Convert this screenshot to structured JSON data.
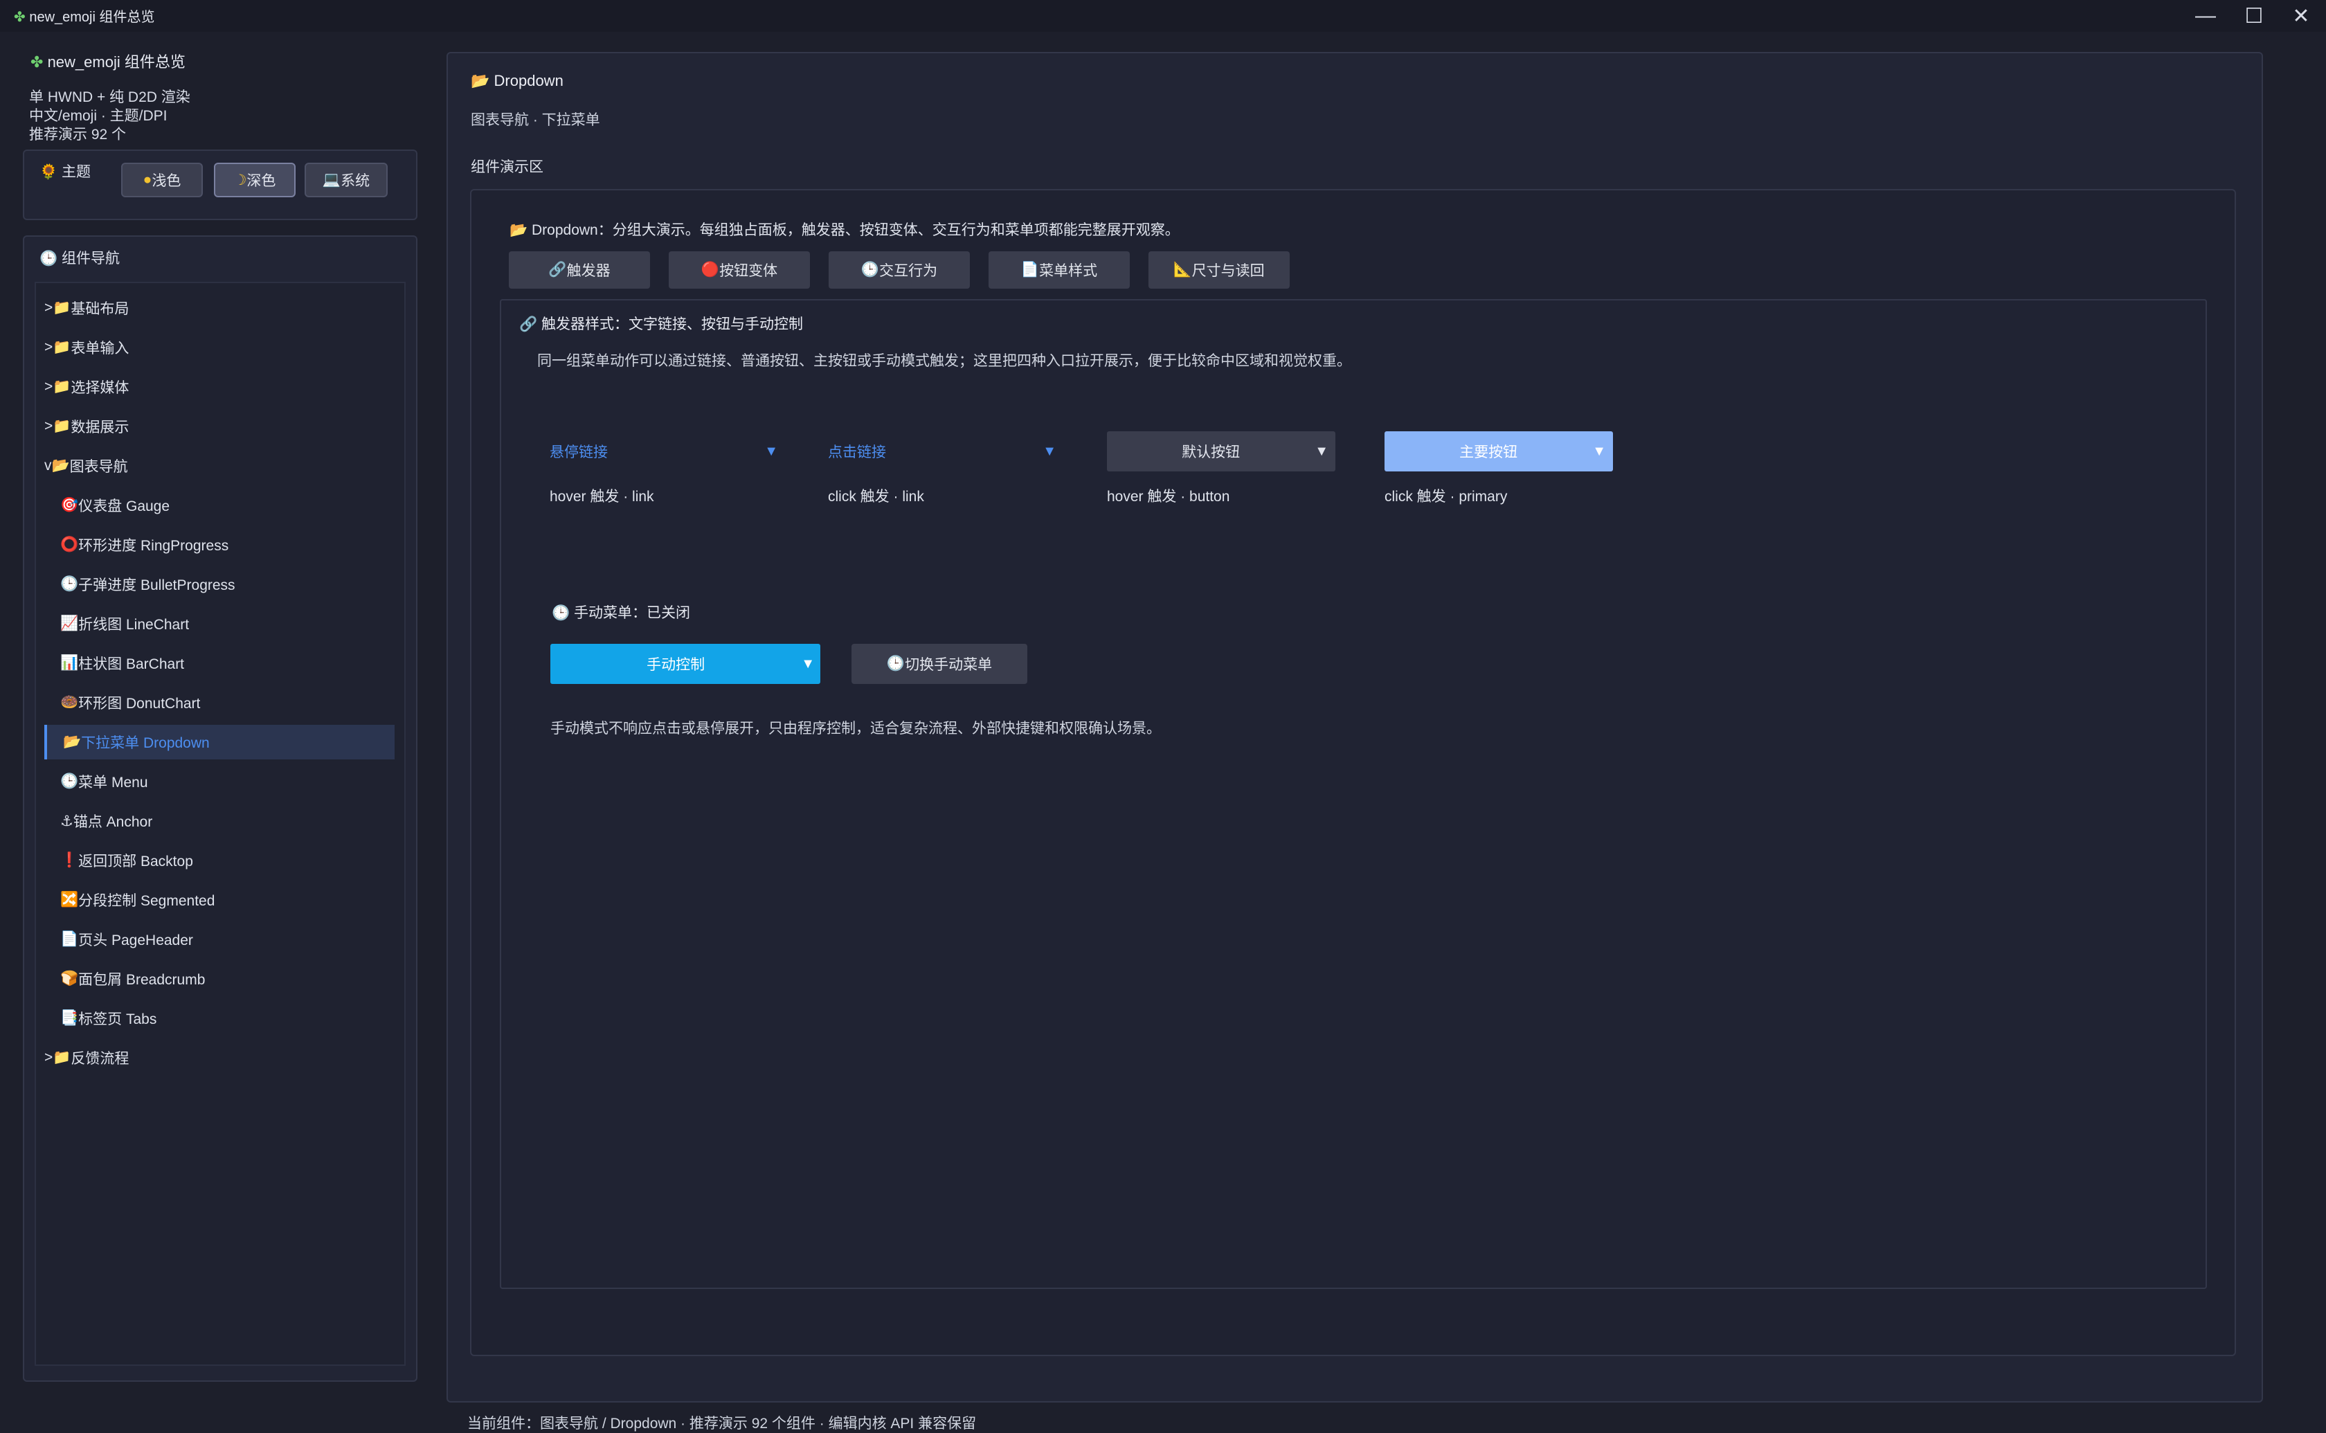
{
  "window": {
    "title": "new_emoji 组件总览"
  },
  "sidebar": {
    "brand": "new_emoji 组件总览",
    "info": [
      "单 HWND + 纯 D2D 渲染",
      "中文/emoji · 主题/DPI",
      "推荐演示 92 个"
    ],
    "theme": {
      "title": "主题",
      "options": [
        "浅色",
        "深色",
        "系统"
      ],
      "selected": "深色"
    },
    "nav": {
      "title": "组件导航",
      "items": [
        {
          "label": "基础布局",
          "prefix": ">"
        },
        {
          "label": "表单输入",
          "prefix": ">"
        },
        {
          "label": "选择媒体",
          "prefix": ">"
        },
        {
          "label": "数据展示",
          "prefix": ">"
        },
        {
          "label": "图表导航",
          "prefix": "v"
        },
        {
          "label": "仪表盘 Gauge"
        },
        {
          "label": "环形进度 RingProgress"
        },
        {
          "label": "子弹进度 BulletProgress"
        },
        {
          "label": "折线图 LineChart"
        },
        {
          "label": "柱状图 BarChart"
        },
        {
          "label": "环形图 DonutChart"
        },
        {
          "label": "下拉菜单 Dropdown"
        },
        {
          "label": "菜单 Menu"
        },
        {
          "label": "锚点 Anchor"
        },
        {
          "label": "返回顶部 Backtop"
        },
        {
          "label": "分段控制 Segmented"
        },
        {
          "label": "页头 PageHeader"
        },
        {
          "label": "面包屑 Breadcrumb"
        },
        {
          "label": "标签页 Tabs"
        },
        {
          "label": "反馈流程",
          "prefix": ">"
        }
      ]
    }
  },
  "main": {
    "title": "Dropdown",
    "subtitle": "图表导航 · 下拉菜单",
    "area_title": "组件演示区",
    "intro": "Dropdown：分组大演示。每组独占面板，触发器、按钮变体、交互行为和菜单项都能完整展开观察。",
    "tabs": [
      "触发器",
      "按钮变体",
      "交互行为",
      "菜单样式",
      "尺寸与读回"
    ],
    "section": {
      "title": "触发器样式：文字链接、按钮与手动控制",
      "desc": "同一组菜单动作可以通过链接、普通按钮、主按钮或手动模式触发；这里把四种入口拉开展示，便于比较命中区域和视觉权重。",
      "triggers": [
        {
          "label": "悬停链接",
          "caption": "hover 触发 · link"
        },
        {
          "label": "点击链接",
          "caption": "click 触发 · link"
        },
        {
          "label": "默认按钮",
          "caption": "hover 触发 · button"
        },
        {
          "label": "主要按钮",
          "caption": "click 触发 · primary"
        }
      ],
      "manual": {
        "status": "手动菜单：已关闭",
        "control_label": "手动控制",
        "toggle_label": "切换手动菜单",
        "note": "手动模式不响应点击或悬停展开，只由程序控制，适合复杂流程、外部快捷键和权限确认场景。"
      }
    }
  },
  "status_bar": "当前组件：图表导航 / Dropdown · 推荐演示 92 个组件 · 编辑内核 API 兼容保留",
  "colors": {
    "accent": "#4d8ef0",
    "primary_btn": "#8ab4f8",
    "manual_btn": "#12a4e8"
  }
}
